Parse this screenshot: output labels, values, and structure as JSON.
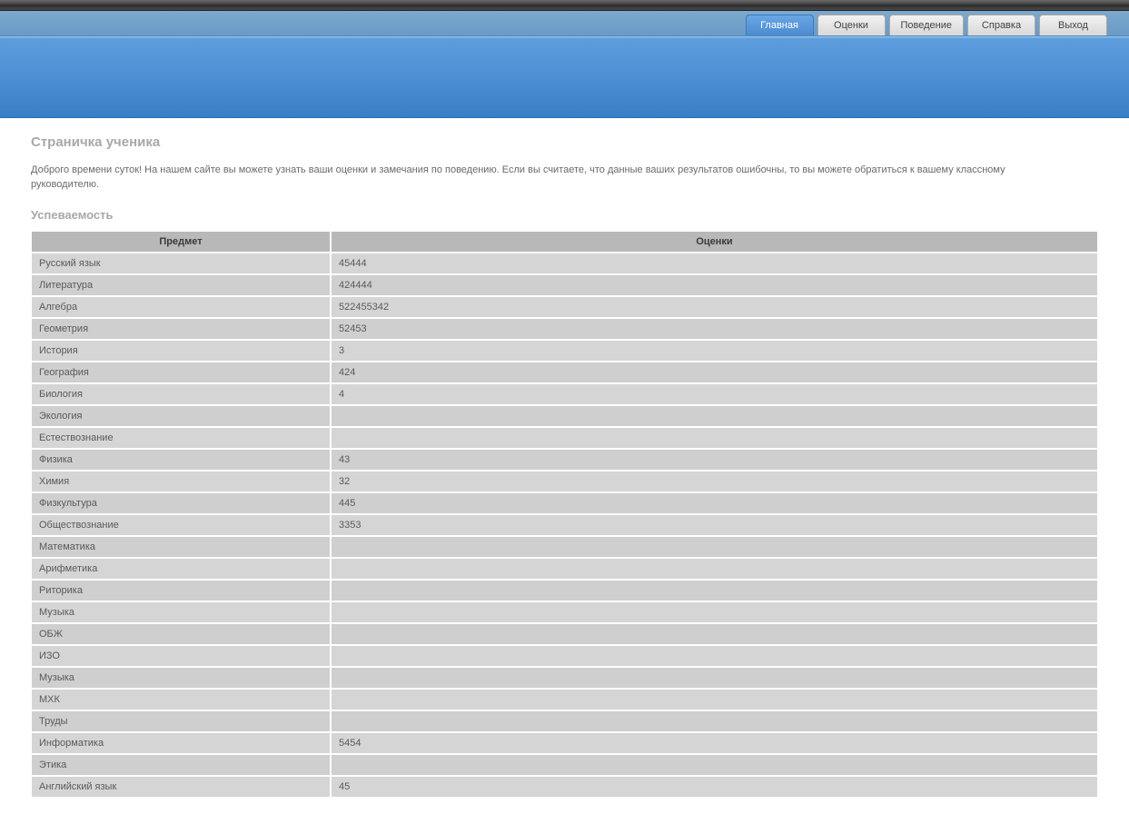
{
  "nav": {
    "tabs": [
      {
        "label": "Главная",
        "active": true
      },
      {
        "label": "Оценки",
        "active": false
      },
      {
        "label": "Поведение",
        "active": false
      },
      {
        "label": "Справка",
        "active": false
      },
      {
        "label": "Выход",
        "active": false
      }
    ]
  },
  "page": {
    "title": "Страничка ученика",
    "intro": "Доброго времени суток! На нашем сайте вы можете узнать ваши оценки и замечания по поведению. Если вы считаете, что данные ваших результатов ошибочны, то вы можете обратиться к вашему классному руководителю.",
    "section_title": "Успеваемость"
  },
  "table": {
    "headers": {
      "subject": "Предмет",
      "grades": "Оценки"
    },
    "rows": [
      {
        "subject": "Русский язык",
        "grades": "45444"
      },
      {
        "subject": "Литература",
        "grades": "424444"
      },
      {
        "subject": "Алгебра",
        "grades": "522455342"
      },
      {
        "subject": "Геометрия",
        "grades": "52453"
      },
      {
        "subject": "История",
        "grades": "3"
      },
      {
        "subject": "География",
        "grades": "424"
      },
      {
        "subject": "Биология",
        "grades": "4"
      },
      {
        "subject": "Экология",
        "grades": ""
      },
      {
        "subject": "Естествознание",
        "grades": ""
      },
      {
        "subject": "Физика",
        "grades": "43"
      },
      {
        "subject": "Химия",
        "grades": "32"
      },
      {
        "subject": "Физкультура",
        "grades": "445"
      },
      {
        "subject": "Обществознание",
        "grades": "3353"
      },
      {
        "subject": "Математика",
        "grades": ""
      },
      {
        "subject": "Арифметика",
        "grades": ""
      },
      {
        "subject": "Риторика",
        "grades": ""
      },
      {
        "subject": "Музыка",
        "grades": ""
      },
      {
        "subject": "ОБЖ",
        "grades": ""
      },
      {
        "subject": "ИЗО",
        "grades": ""
      },
      {
        "subject": "Музыка",
        "grades": ""
      },
      {
        "subject": "МХК",
        "grades": ""
      },
      {
        "subject": "Труды",
        "grades": ""
      },
      {
        "subject": "Информатика",
        "grades": "5454"
      },
      {
        "subject": "Этика",
        "grades": ""
      },
      {
        "subject": "Английский язык",
        "grades": "45"
      }
    ]
  }
}
